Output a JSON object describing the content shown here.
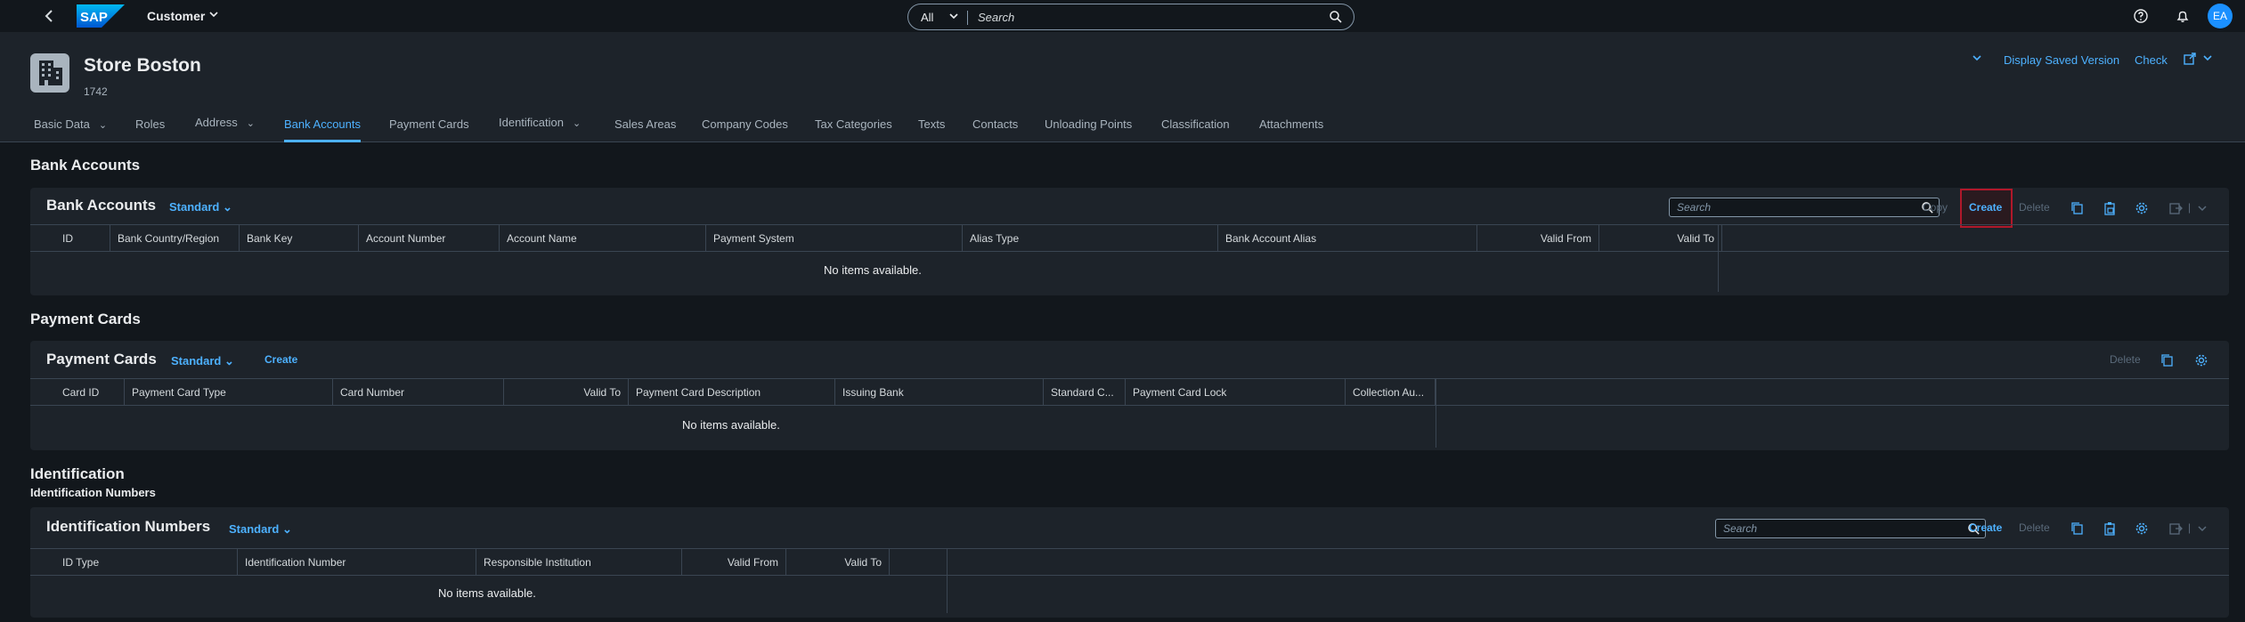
{
  "shell": {
    "product": "Customer",
    "search_scope": "All",
    "search_placeholder": "Search",
    "avatar": "EA",
    "logo_text": "SAP"
  },
  "header": {
    "title": "Store Boston",
    "subtitle": "1742",
    "actions": [
      "Display Saved Version",
      "Check"
    ]
  },
  "tabs": [
    {
      "label": "Basic Data",
      "has_menu": true
    },
    {
      "label": "Roles",
      "has_menu": false
    },
    {
      "label": "Address",
      "has_menu": true
    },
    {
      "label": "Bank Accounts",
      "has_menu": false,
      "selected": true
    },
    {
      "label": "Payment Cards",
      "has_menu": false
    },
    {
      "label": "Identification",
      "has_menu": true
    },
    {
      "label": "Sales Areas",
      "has_menu": false
    },
    {
      "label": "Company Codes",
      "has_menu": false
    },
    {
      "label": "Tax Categories",
      "has_menu": false
    },
    {
      "label": "Texts",
      "has_menu": false
    },
    {
      "label": "Contacts",
      "has_menu": false
    },
    {
      "label": "Unloading Points",
      "has_menu": false
    },
    {
      "label": "Classification",
      "has_menu": false
    },
    {
      "label": "Attachments",
      "has_menu": false
    }
  ],
  "bank": {
    "section_title": "Bank Accounts",
    "table_title": "Bank Accounts",
    "variant": "Standard",
    "search_placeholder": "Search",
    "copy": "Copy",
    "create": "Create",
    "delete": "Delete",
    "columns": [
      "ID",
      "Bank Country/Region",
      "Bank Key",
      "Account Number",
      "Account Name",
      "Payment System",
      "Alias Type",
      "Bank Account Alias",
      "Valid From",
      "Valid To"
    ],
    "empty": "No items available."
  },
  "cards": {
    "section_title": "Payment Cards",
    "table_title": "Payment Cards",
    "variant": "Standard",
    "create": "Create",
    "delete": "Delete",
    "columns": [
      "Card ID",
      "Payment Card Type",
      "Card Number",
      "Valid To",
      "Payment Card Description",
      "Issuing Bank",
      "Standard C...",
      "Payment Card Lock",
      "Collection Au..."
    ],
    "empty": "No items available."
  },
  "ident": {
    "section_title": "Identification",
    "sub_title": "Identification Numbers",
    "table_title": "Identification Numbers",
    "variant": "Standard",
    "search_placeholder": "Search",
    "create": "Create",
    "delete": "Delete",
    "columns": [
      "ID Type",
      "Identification Number",
      "Responsible Institution",
      "Valid From",
      "Valid To"
    ],
    "empty": "No items available."
  },
  "colors": {
    "accent": "#4db1ff",
    "background": "#12171c",
    "panel": "#1d232a",
    "highlight": "#b0182a"
  }
}
